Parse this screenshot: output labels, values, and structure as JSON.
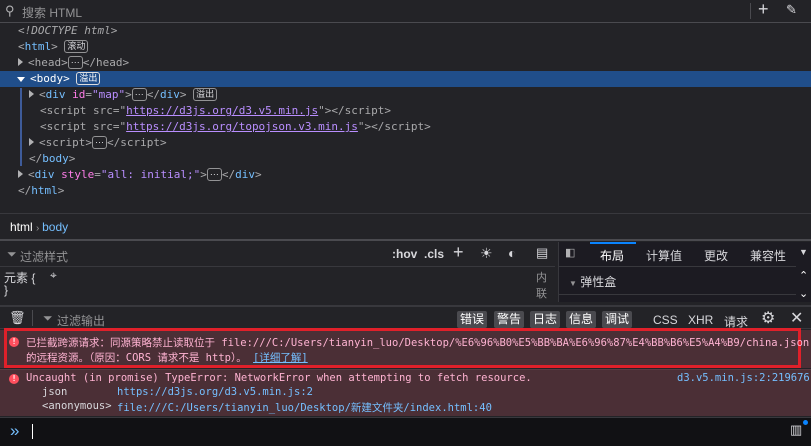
{
  "search": {
    "placeholder": "搜索 HTML"
  },
  "tree": {
    "doctype": "<!DOCTYPE html>",
    "html_badge": "滚动",
    "overflow_badge": "溢出",
    "head": "head",
    "body": "body",
    "div": "div",
    "script": "script",
    "html": "html",
    "map_attr": "id",
    "map_val": "\"map\"",
    "src": "src",
    "url1": "https://d3js.org/d3.v5.min.js",
    "url2": "https://d3js.org/topojson.v3.min.js",
    "style_attr": "style",
    "style_val": "\"all: initial;\"",
    "ellipsis": "⋯"
  },
  "breadcrumb": [
    "html",
    "body"
  ],
  "rules": {
    "filter_placeholder": "过滤样式",
    "hov": ":hov",
    "cls": ".cls",
    "element": "元素 {",
    "close": "}",
    "inline": "内联"
  },
  "sidebar": {
    "tabs": [
      "布局",
      "计算值",
      "更改",
      "兼容性"
    ],
    "active": "布局",
    "section": "弹性盒"
  },
  "console": {
    "filter_placeholder": "过滤输出",
    "filters": [
      "错误",
      "警告",
      "日志",
      "信息",
      "调试"
    ],
    "extra": [
      "CSS",
      "XHR",
      "请求"
    ],
    "messages": [
      {
        "text": "已拦截跨源请求：同源策略禁止读取位于 file:///C:/Users/tianyin_luo/Desktop/%E6%96%B0%E5%BB%BA%E6%96%87%E4%BB%B6%E5%A4%B9/china.json",
        "text2": "的远程资源。（原因：CORS 请求不是 http）。",
        "link": "[详细了解]"
      },
      {
        "text": "Uncaught (in promise) TypeError: NetworkError when attempting to fetch resource.",
        "source": "d3.v5.min.js:2:219676",
        "stack": [
          {
            "fn": "json",
            "loc": "https://d3js.org/d3.v5.min.js:2"
          },
          {
            "fn": "<anonymous>",
            "loc": "file:///C:/Users/tianyin_luo/Desktop/新建文件夹/index.html:40"
          }
        ]
      }
    ],
    "prompt": "»"
  },
  "colors": {
    "selection": "#204e8a",
    "error_bg": "#4b2f36",
    "highlight_box": "#e0202a",
    "accent": "#0a84ff"
  }
}
